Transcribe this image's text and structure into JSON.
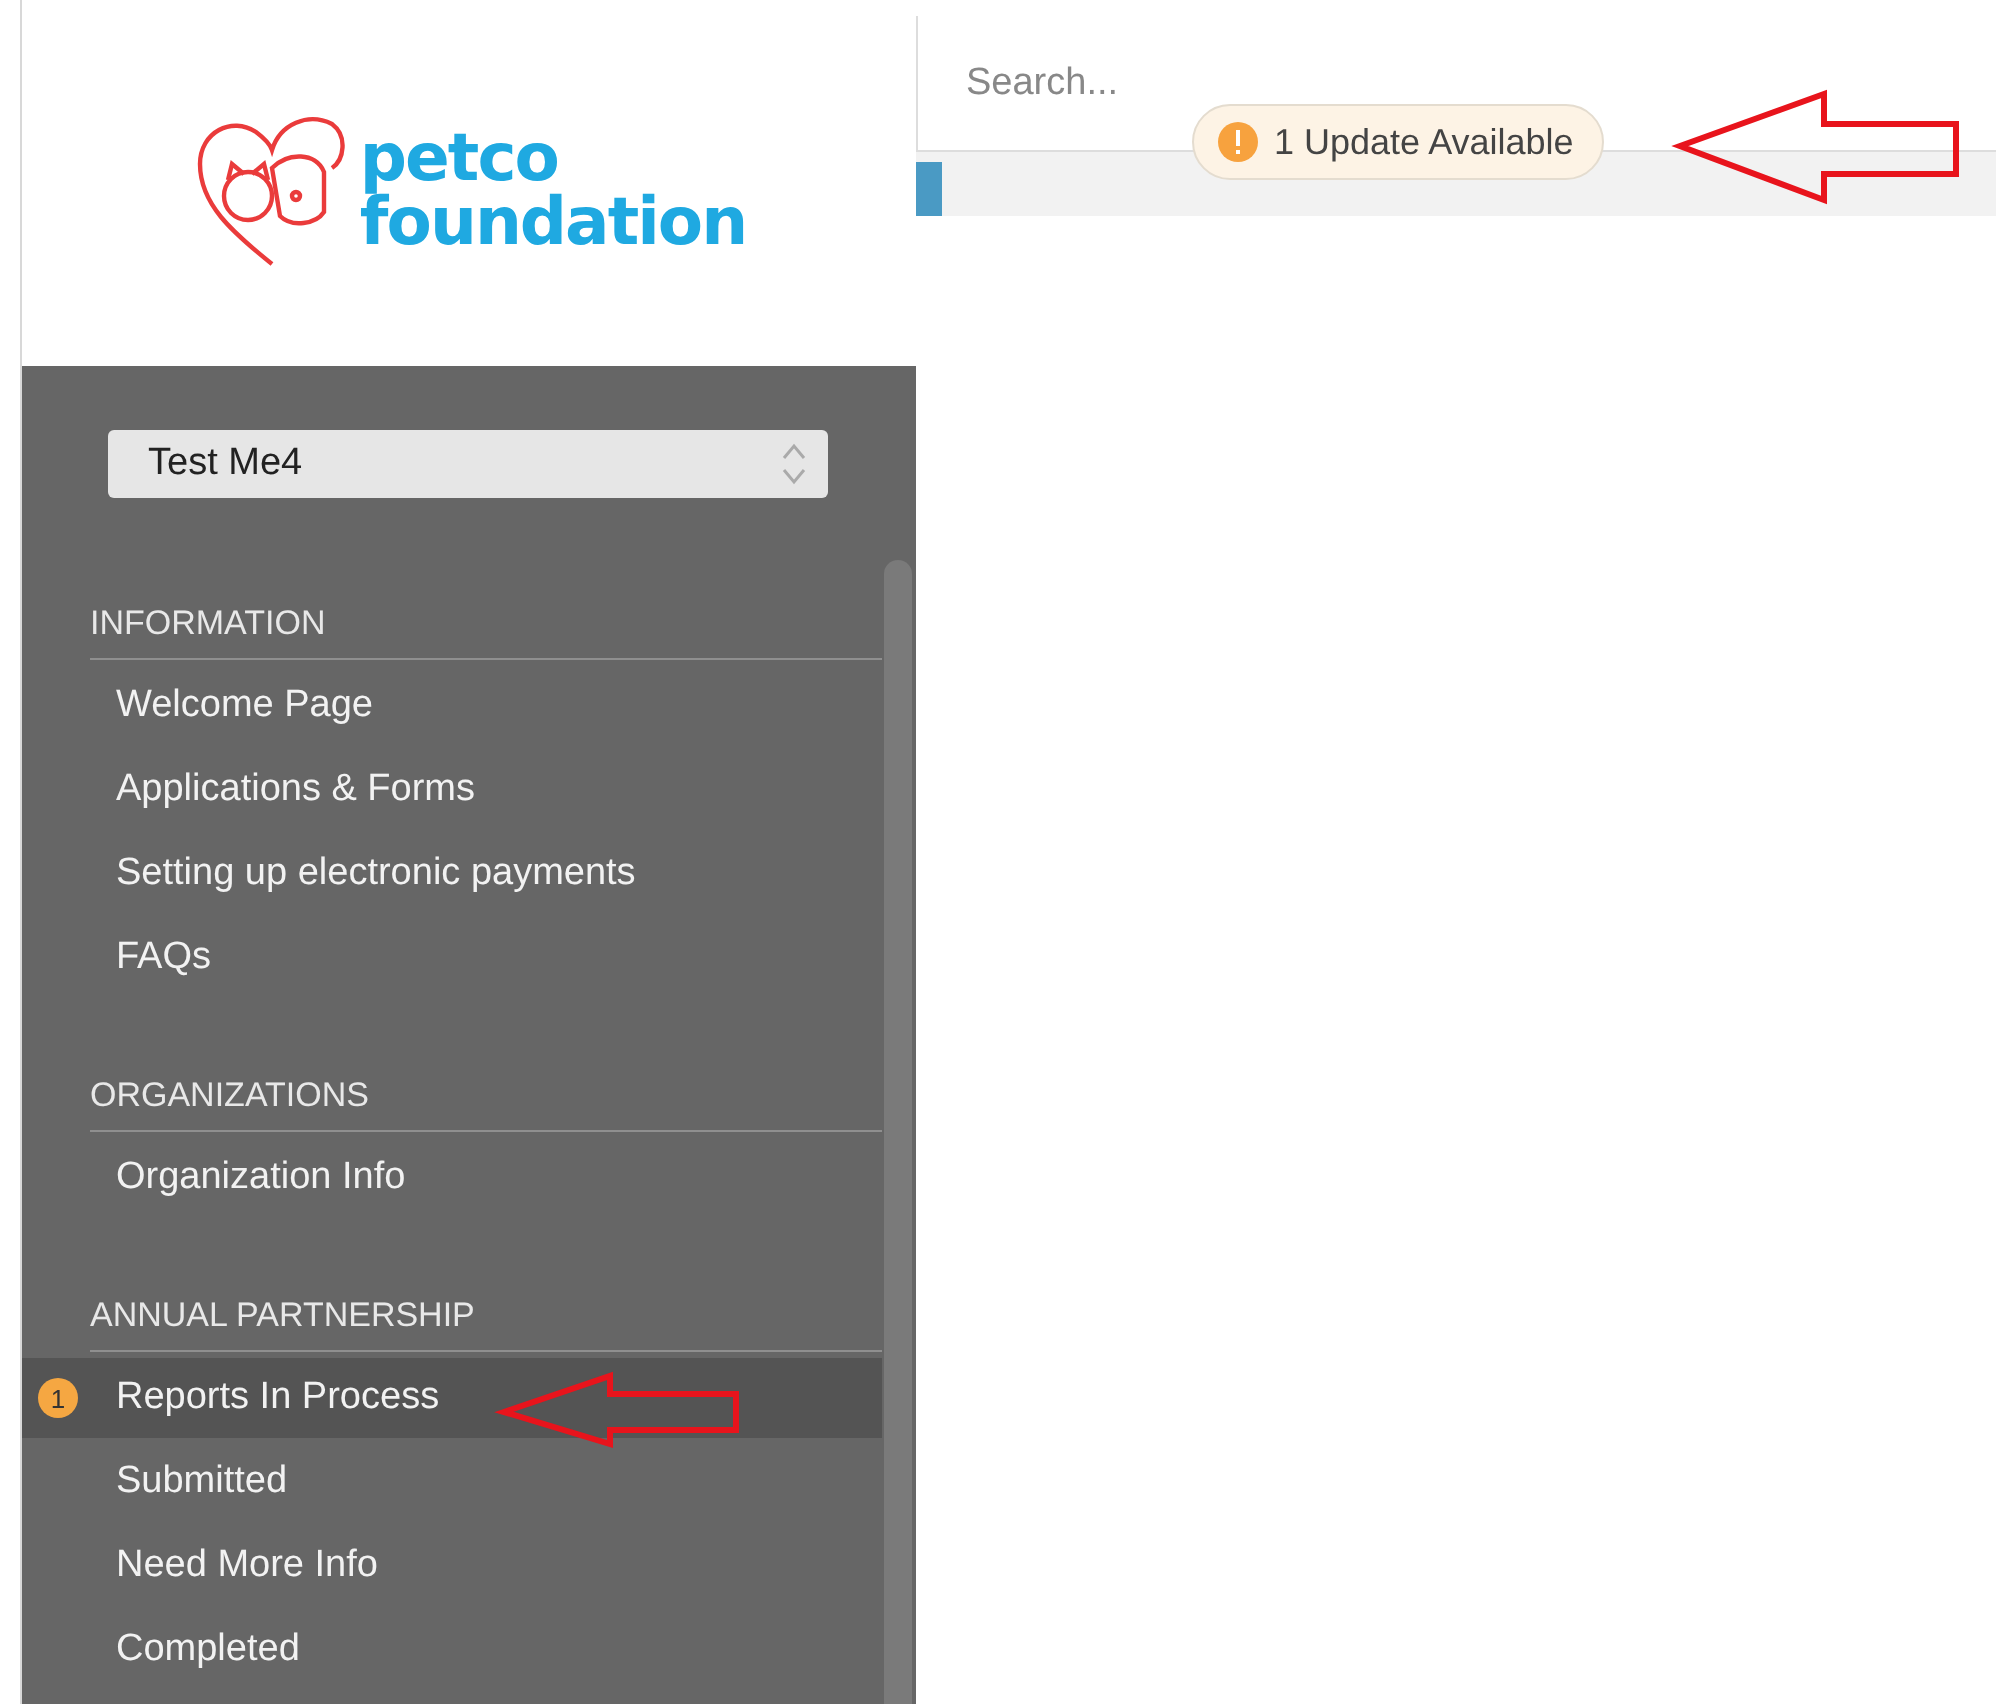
{
  "logo": {
    "lines": [
      "petco",
      "foundation"
    ]
  },
  "org_select": {
    "value": "Test Me4"
  },
  "sections": [
    {
      "title": "INFORMATION",
      "items": [
        {
          "label": "Welcome Page",
          "selected": false
        },
        {
          "label": "Applications & Forms",
          "selected": false
        },
        {
          "label": "Setting up electronic payments",
          "selected": false
        },
        {
          "label": "FAQs",
          "selected": false
        }
      ]
    },
    {
      "title": "ORGANIZATIONS",
      "items": [
        {
          "label": "Organization Info",
          "selected": false
        }
      ]
    },
    {
      "title": "ANNUAL PARTNERSHIP",
      "items": [
        {
          "label": "Reports In Process",
          "selected": true,
          "badge": "1"
        },
        {
          "label": "Submitted",
          "selected": false
        },
        {
          "label": "Need More Info",
          "selected": false
        },
        {
          "label": "Completed",
          "selected": false
        }
      ]
    }
  ],
  "search": {
    "placeholder": "Search..."
  },
  "update_notice": {
    "text": "1 Update Available"
  }
}
